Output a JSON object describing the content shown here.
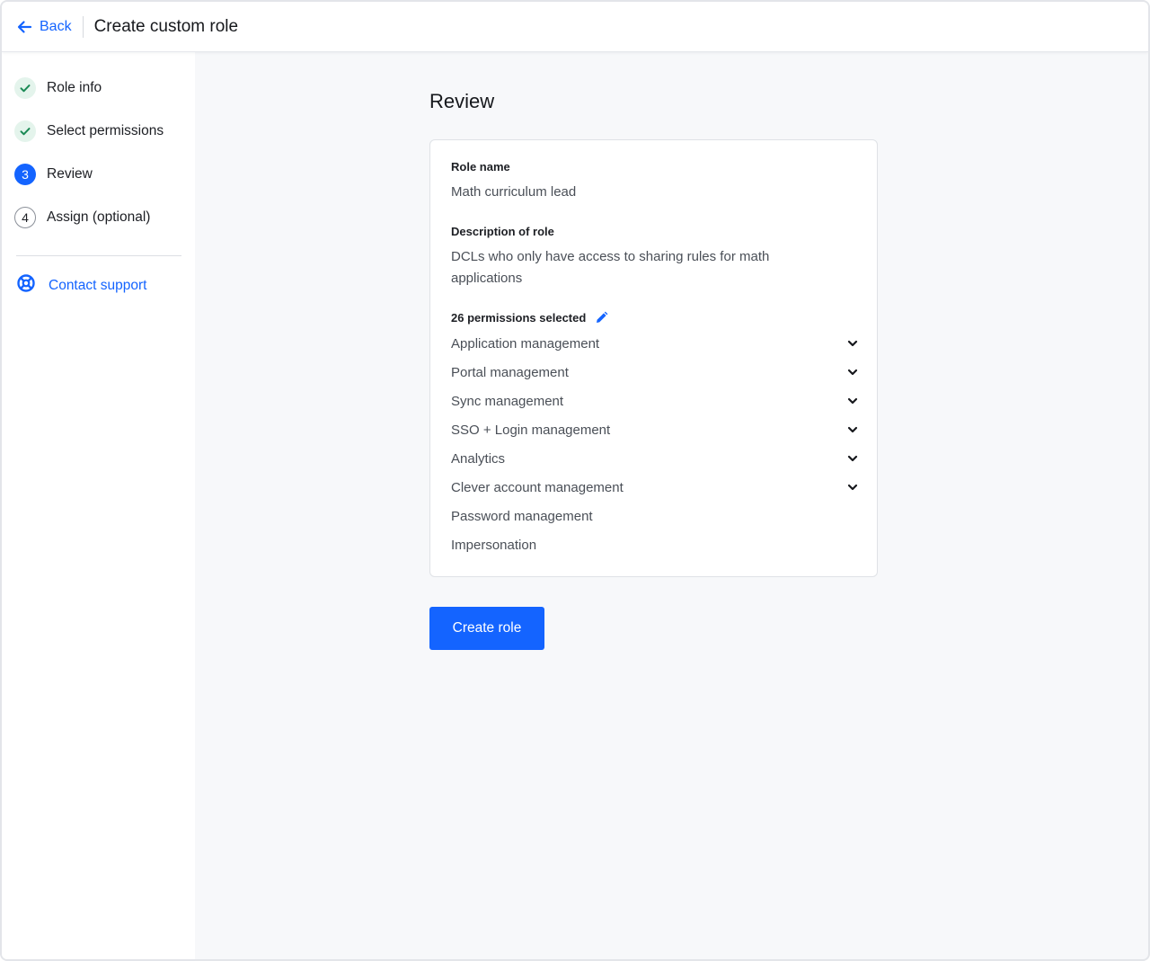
{
  "header": {
    "back_label": "Back",
    "title": "Create custom role"
  },
  "sidebar": {
    "steps": [
      {
        "label": "Role info",
        "status": "complete",
        "marker": ""
      },
      {
        "label": "Select permissions",
        "status": "complete",
        "marker": ""
      },
      {
        "label": "Review",
        "status": "current",
        "marker": "3"
      },
      {
        "label": "Assign (optional)",
        "status": "pending",
        "marker": "4"
      }
    ],
    "support_label": "Contact support"
  },
  "review": {
    "title": "Review",
    "role_name_label": "Role name",
    "role_name": "Math curriculum lead",
    "description_label": "Description of role",
    "description_line1": "DCLs who only have access to sharing rules for math",
    "description_line2": "applications",
    "permissions_label": "26 permissions selected",
    "permissions": [
      {
        "label": "Application management",
        "expandable": true
      },
      {
        "label": "Portal management",
        "expandable": true
      },
      {
        "label": "Sync management",
        "expandable": true
      },
      {
        "label": "SSO + Login management",
        "expandable": true
      },
      {
        "label": "Analytics",
        "expandable": true
      },
      {
        "label": "Clever account management",
        "expandable": true
      },
      {
        "label": "Password management",
        "expandable": false
      },
      {
        "label": "Impersonation",
        "expandable": false
      }
    ]
  },
  "actions": {
    "create_label": "Create role"
  },
  "colors": {
    "accent": "#1464ff",
    "check_green": "#1a8a55",
    "check_bg": "#e4f4ec",
    "background": "#f7f8fa"
  }
}
